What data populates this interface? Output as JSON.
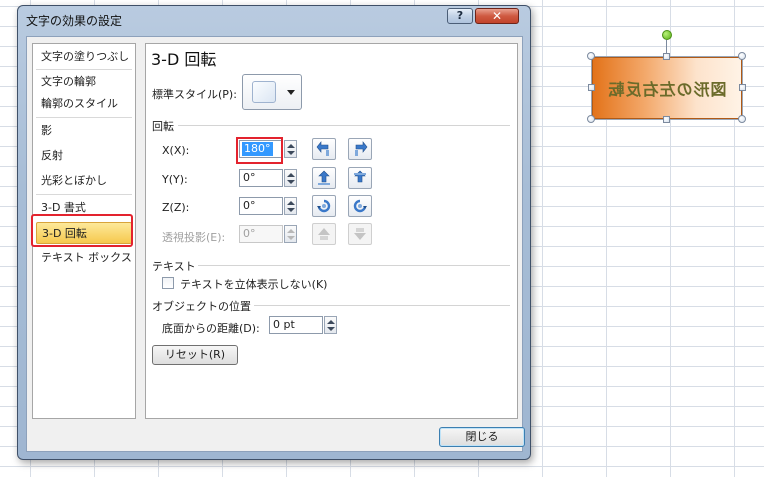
{
  "dialog": {
    "title": "文字の効果の設定",
    "help_label": "?",
    "close_label": "✕",
    "close_button_label": "閉じる"
  },
  "categories": [
    {
      "label": "文字の塗りつぶし"
    },
    {
      "label": "文字の輪郭"
    },
    {
      "label": "輪郭のスタイル"
    },
    {
      "label": "影"
    },
    {
      "label": "反射"
    },
    {
      "label": "光彩とぼかし"
    },
    {
      "label": "3-D 書式"
    },
    {
      "label": "3-D 回転",
      "selected": true
    },
    {
      "label": "テキスト ボックス"
    }
  ],
  "panel": {
    "title": "3-D 回転",
    "preset_label": "標準スタイル(P):",
    "rotation_header": "回転",
    "x_label": "X(X):",
    "x_value": "180°",
    "y_label": "Y(Y):",
    "y_value": "0°",
    "z_label": "Z(Z):",
    "z_value": "0°",
    "perspective_label": "透視投影(E):",
    "perspective_value": "0°",
    "text_header": "テキスト",
    "keep_flat_label": "テキストを立体表示しない(K)",
    "keep_flat_checked": false,
    "object_position_header": "オブジェクトの位置",
    "distance_label": "底面からの距離(D):",
    "distance_value": "0 pt",
    "reset_label": "リセット(R)"
  },
  "shape": {
    "text": "図形の左右反転",
    "fill_start": "#e3731a",
    "fill_end": "#fff3e6",
    "text_color": "#6b6b2a"
  },
  "accent": {
    "highlight_red": "#e3232e",
    "selection_gold": "#f6c94e"
  }
}
